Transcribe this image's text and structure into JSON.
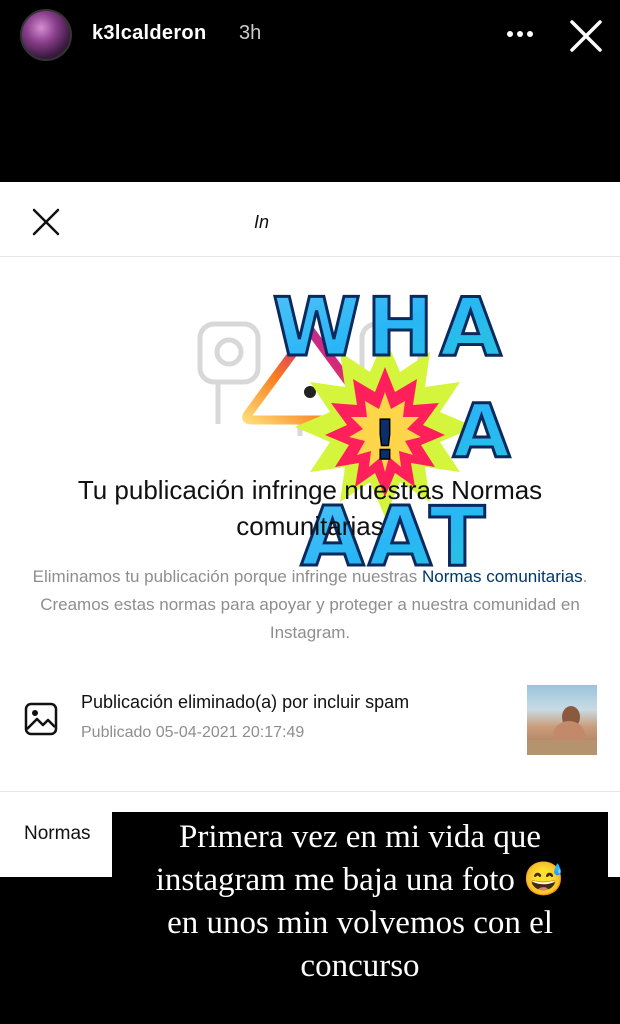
{
  "story": {
    "username": "k3lcalderon",
    "time": "3h",
    "more_icon": "more-horizontal-icon",
    "close_icon": "close-icon"
  },
  "sheet": {
    "title": "In",
    "close_icon": "close-icon",
    "headline": "Tu publicación infringe nuestras Normas comunitarias",
    "body_prefix": "Eliminamos tu publicación porque infringe nuestras ",
    "body_link": "Normas comunitarias",
    "body_suffix": ". Creamos estas normas para apoyar y proteger a nuestra comunidad en Instagram.",
    "post": {
      "icon": "image-icon",
      "title": "Publicación eliminado(a) por incluir spam",
      "date": "Publicado 05-04-2021 20:17:49"
    },
    "footer_label": "Normas"
  },
  "sticker": {
    "lines": [
      "WHA",
      "A A",
      "AAT"
    ],
    "exclamation": "!"
  },
  "caption": {
    "line1": "Primera vez en mi vida que",
    "line2": "instagram me baja una foto 😅",
    "line3": "en unos min volvemos con el",
    "line4": "concurso"
  },
  "colors": {
    "background": "#000000",
    "sheet": "#ffffff",
    "link": "#00376b",
    "muted": "#8e8e8e"
  }
}
